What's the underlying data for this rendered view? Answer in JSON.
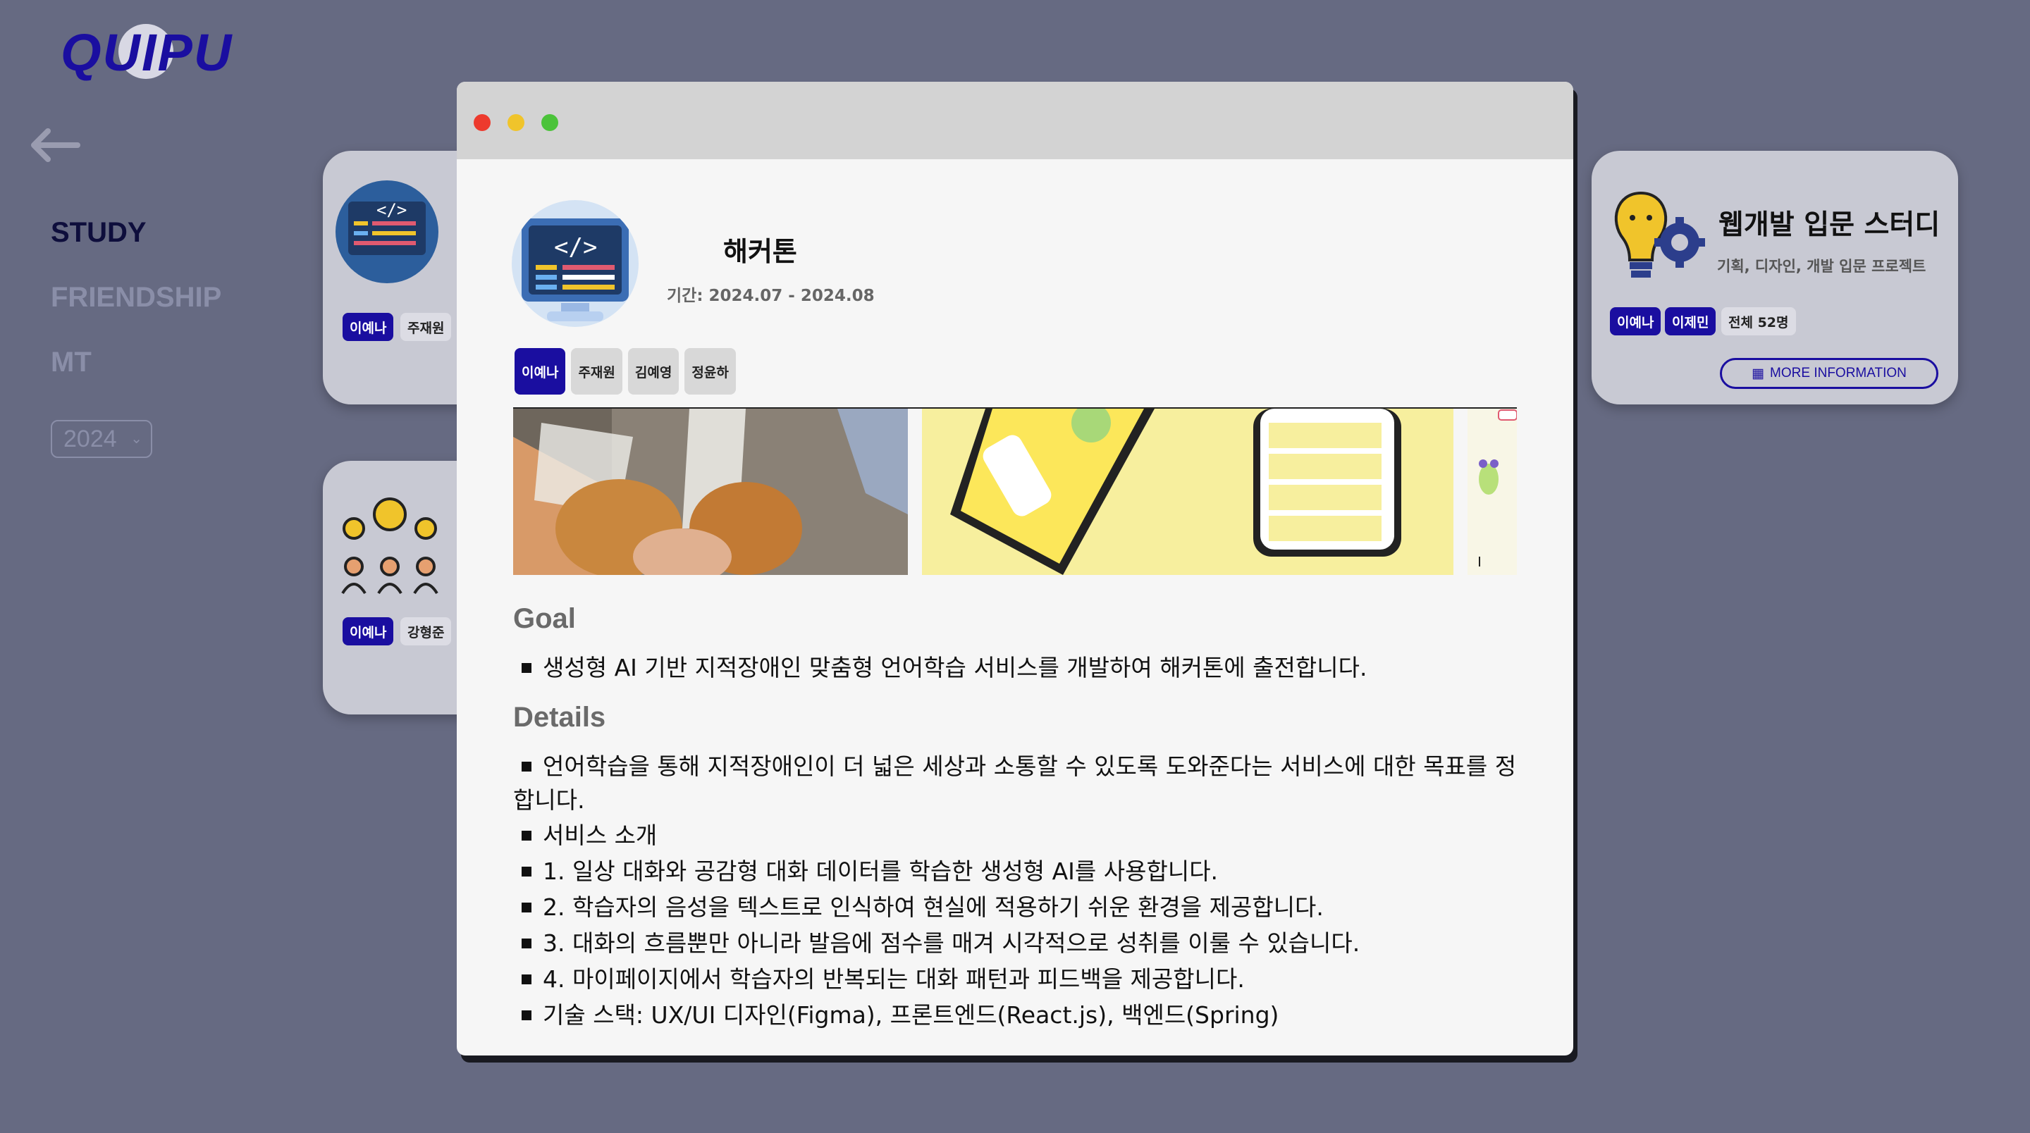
{
  "logo": {
    "text": "QUIPU"
  },
  "nav": {
    "back_icon": "arrow-left-icon",
    "items": [
      {
        "label": "STUDY",
        "active": true
      },
      {
        "label": "FRIENDSHIP",
        "active": false
      },
      {
        "label": "MT",
        "active": false
      }
    ],
    "year": "2024"
  },
  "cards": {
    "card1": {
      "members": [
        "이예나",
        "주재원"
      ]
    },
    "card2": {
      "members": [
        "이예나",
        "강형준"
      ]
    },
    "card3": {
      "title": "웹개발 입문 스터디",
      "subtitle": "기획, 디자인, 개발 입문 프로젝트",
      "members": [
        "이예나",
        "이제민"
      ],
      "total": "전체 52명",
      "more_button": "MORE INFORMATION"
    }
  },
  "modal": {
    "title": "해커톤",
    "period": "기간: 2024.07 - 2024.08",
    "tabs": [
      {
        "label": "이예나",
        "active": true
      },
      {
        "label": "주재원",
        "active": false
      },
      {
        "label": "김예영",
        "active": false
      },
      {
        "label": "정윤하",
        "active": false
      }
    ],
    "goal_heading": "Goal",
    "goal": "생성형 AI 기반 지적장애인 맞춤형 언어학습 서비스를 개발하여 해커톤에 출전합니다.",
    "details_heading": "Details",
    "details": [
      "언어학습을 통해 지적장애인이 더 넓은 세상과 소통할 수 있도록 도와준다는 서비스에 대한 목표를 정합니다.",
      "서비스 소개",
      "1. 일상 대화와 공감형 대화 데이터를 학습한 생성형 AI를 사용합니다.",
      "2. 학습자의 음성을 텍스트로 인식하여 현실에 적용하기 쉬운 환경을 제공합니다.",
      "3. 대화의 흐름뿐만 아니라 발음에 점수를 매겨 시각적으로 성취를 이룰 수 있습니다.",
      "4. 마이페이지에서 학습자의 반복되는 대화 패턴과 피드백을 제공합니다.",
      "기술 스택: UX/UI 디자인(Figma), 프론트엔드(React.js), 백엔드(Spring)"
    ]
  },
  "colors": {
    "accent": "#1a0ea0",
    "background": "#666a82"
  }
}
